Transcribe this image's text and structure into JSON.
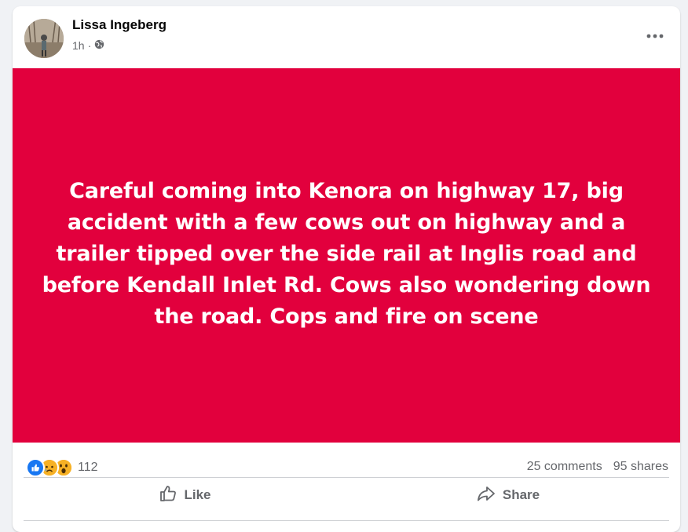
{
  "post": {
    "author": "Lissa Ingeberg",
    "time": "1h",
    "separator": "·",
    "audience_icon": "globe-icon",
    "more_icon": "more-options-icon",
    "banner_color": "#e2003d",
    "banner_text": "Careful coming into Kenora on highway 17, big accident with a few cows out on highway and a trailer tipped over the side rail at Inglis road and before Kendall Inlet Rd. Cows also wondering down the road. Cops and fire on scene"
  },
  "stats": {
    "reactions": [
      "like-reaction-icon",
      "sad-reaction-icon",
      "wow-reaction-icon"
    ],
    "reaction_count": "112",
    "comments": "25 comments",
    "shares": "95 shares"
  },
  "actions": {
    "like_label": "Like",
    "share_label": "Share"
  }
}
